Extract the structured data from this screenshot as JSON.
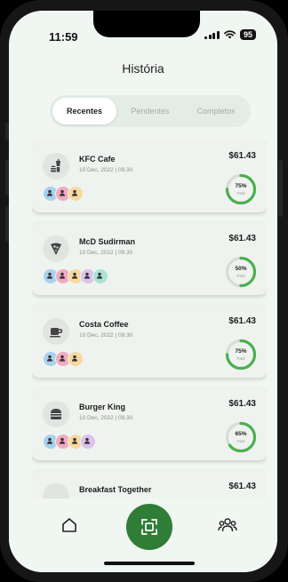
{
  "status_bar": {
    "time": "11:59",
    "battery": "95"
  },
  "header": {
    "title": "História"
  },
  "tabs": [
    {
      "label": "Recentes",
      "active": true
    },
    {
      "label": "Pendentes",
      "active": false
    },
    {
      "label": "Completos",
      "active": false
    }
  ],
  "colors": {
    "accent": "#2f7d36",
    "ring": "#4caf50",
    "ring_track": "#d6ddd6",
    "background": "#f0f6f1"
  },
  "bills": [
    {
      "name": "KFC Cafe",
      "date": "10 Dec, 2022 | 09.30",
      "amount": "$61.43",
      "percent": 75,
      "percent_label": "75%",
      "paid_label": "Paid",
      "icon": "fastfood-icon",
      "avatars": [
        "#a9d1ee",
        "#f2aac2",
        "#f7d9a0"
      ]
    },
    {
      "name": "McD Sudirman",
      "date": "10 Dec, 2022 | 09.30",
      "amount": "$61.43",
      "percent": 50,
      "percent_label": "50%",
      "paid_label": "Paid",
      "icon": "pizza-slice-icon",
      "avatars": [
        "#a9d1ee",
        "#f2aac2",
        "#f7d9a0",
        "#dcc2ec",
        "#a9e3d5"
      ]
    },
    {
      "name": "Costa Coffee",
      "date": "10 Dec, 2022 | 09.30",
      "amount": "$61.43",
      "percent": 75,
      "percent_label": "75%",
      "paid_label": "Paid",
      "icon": "coffee-cup-icon",
      "avatars": [
        "#a9d1ee",
        "#f2aac2",
        "#f7d9a0"
      ]
    },
    {
      "name": "Burger King",
      "date": "10 Dec, 2022 | 09.30",
      "amount": "$61.43",
      "percent": 65,
      "percent_label": "65%",
      "paid_label": "Paid",
      "icon": "burger-icon",
      "avatars": [
        "#a9d1ee",
        "#f2aac2",
        "#f7d9a0",
        "#dcc2ec"
      ]
    },
    {
      "name": "Breakfast Together",
      "date": "",
      "amount": "$61.43",
      "percent": 0,
      "percent_label": "",
      "paid_label": "",
      "icon": "utensils-icon",
      "avatars": []
    }
  ],
  "nav": [
    {
      "name": "home-icon"
    },
    {
      "name": "scan-icon"
    },
    {
      "name": "group-icon"
    }
  ]
}
